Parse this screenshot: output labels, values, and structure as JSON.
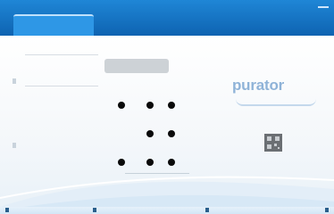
{
  "window": {
    "title": "",
    "accent_color": "#1a78c8"
  },
  "tab": {
    "label": ""
  },
  "table": {
    "header": "",
    "rows": [
      {
        "a": "",
        "b": ""
      },
      {
        "a": "",
        "b": ""
      },
      {
        "a": "",
        "b": ""
      }
    ]
  },
  "action": {
    "label": ""
  },
  "dot_grid": {
    "row_labels": [
      "",
      "",
      ""
    ],
    "rows": [
      [
        true,
        true,
        true
      ],
      [
        false,
        true,
        true
      ],
      [
        true,
        true,
        true
      ]
    ]
  },
  "brand": {
    "name": "purator",
    "subtitle": ""
  },
  "qr": {
    "label": ""
  },
  "footer": {
    "markers": [
      "",
      "",
      "",
      ""
    ]
  }
}
